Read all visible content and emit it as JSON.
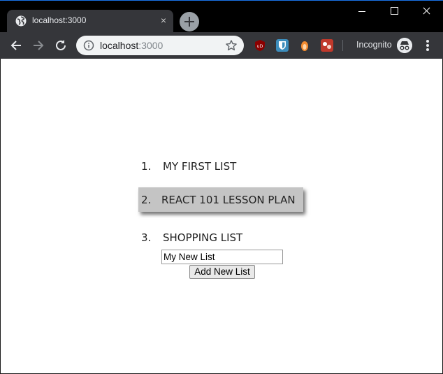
{
  "browser": {
    "tab_title": "localhost:3000",
    "tab_close_glyph": "×",
    "url_host": "localhost",
    "url_port": ":3000",
    "incognito_label": "Incognito",
    "icons": [
      "globe-icon",
      "new-tab-icon",
      "minimize-icon",
      "maximize-icon",
      "close-icon",
      "back-arrow-icon",
      "forward-arrow-icon",
      "reload-icon",
      "info-icon",
      "star-icon",
      "ublock-icon",
      "bitwarden-icon",
      "extension-icon",
      "extension-icon",
      "incognito-icon",
      "menu-icon"
    ],
    "colors": {
      "titlebar": "#000000",
      "toolbar": "#35363a",
      "omnibox": "#f1f3f4",
      "accent": "#1a73e8"
    }
  },
  "lists": {
    "items": [
      {
        "number": "1.",
        "label": "MY FIRST LIST"
      },
      {
        "number": "2.",
        "label": "REACT 101 LESSON PLAN",
        "highlighted": true
      },
      {
        "number": "3.",
        "label": "SHOPPING LIST"
      }
    ],
    "new_list_value": "My New List",
    "add_button_label": "Add New List",
    "highlight_color": "#c4c4c4"
  }
}
